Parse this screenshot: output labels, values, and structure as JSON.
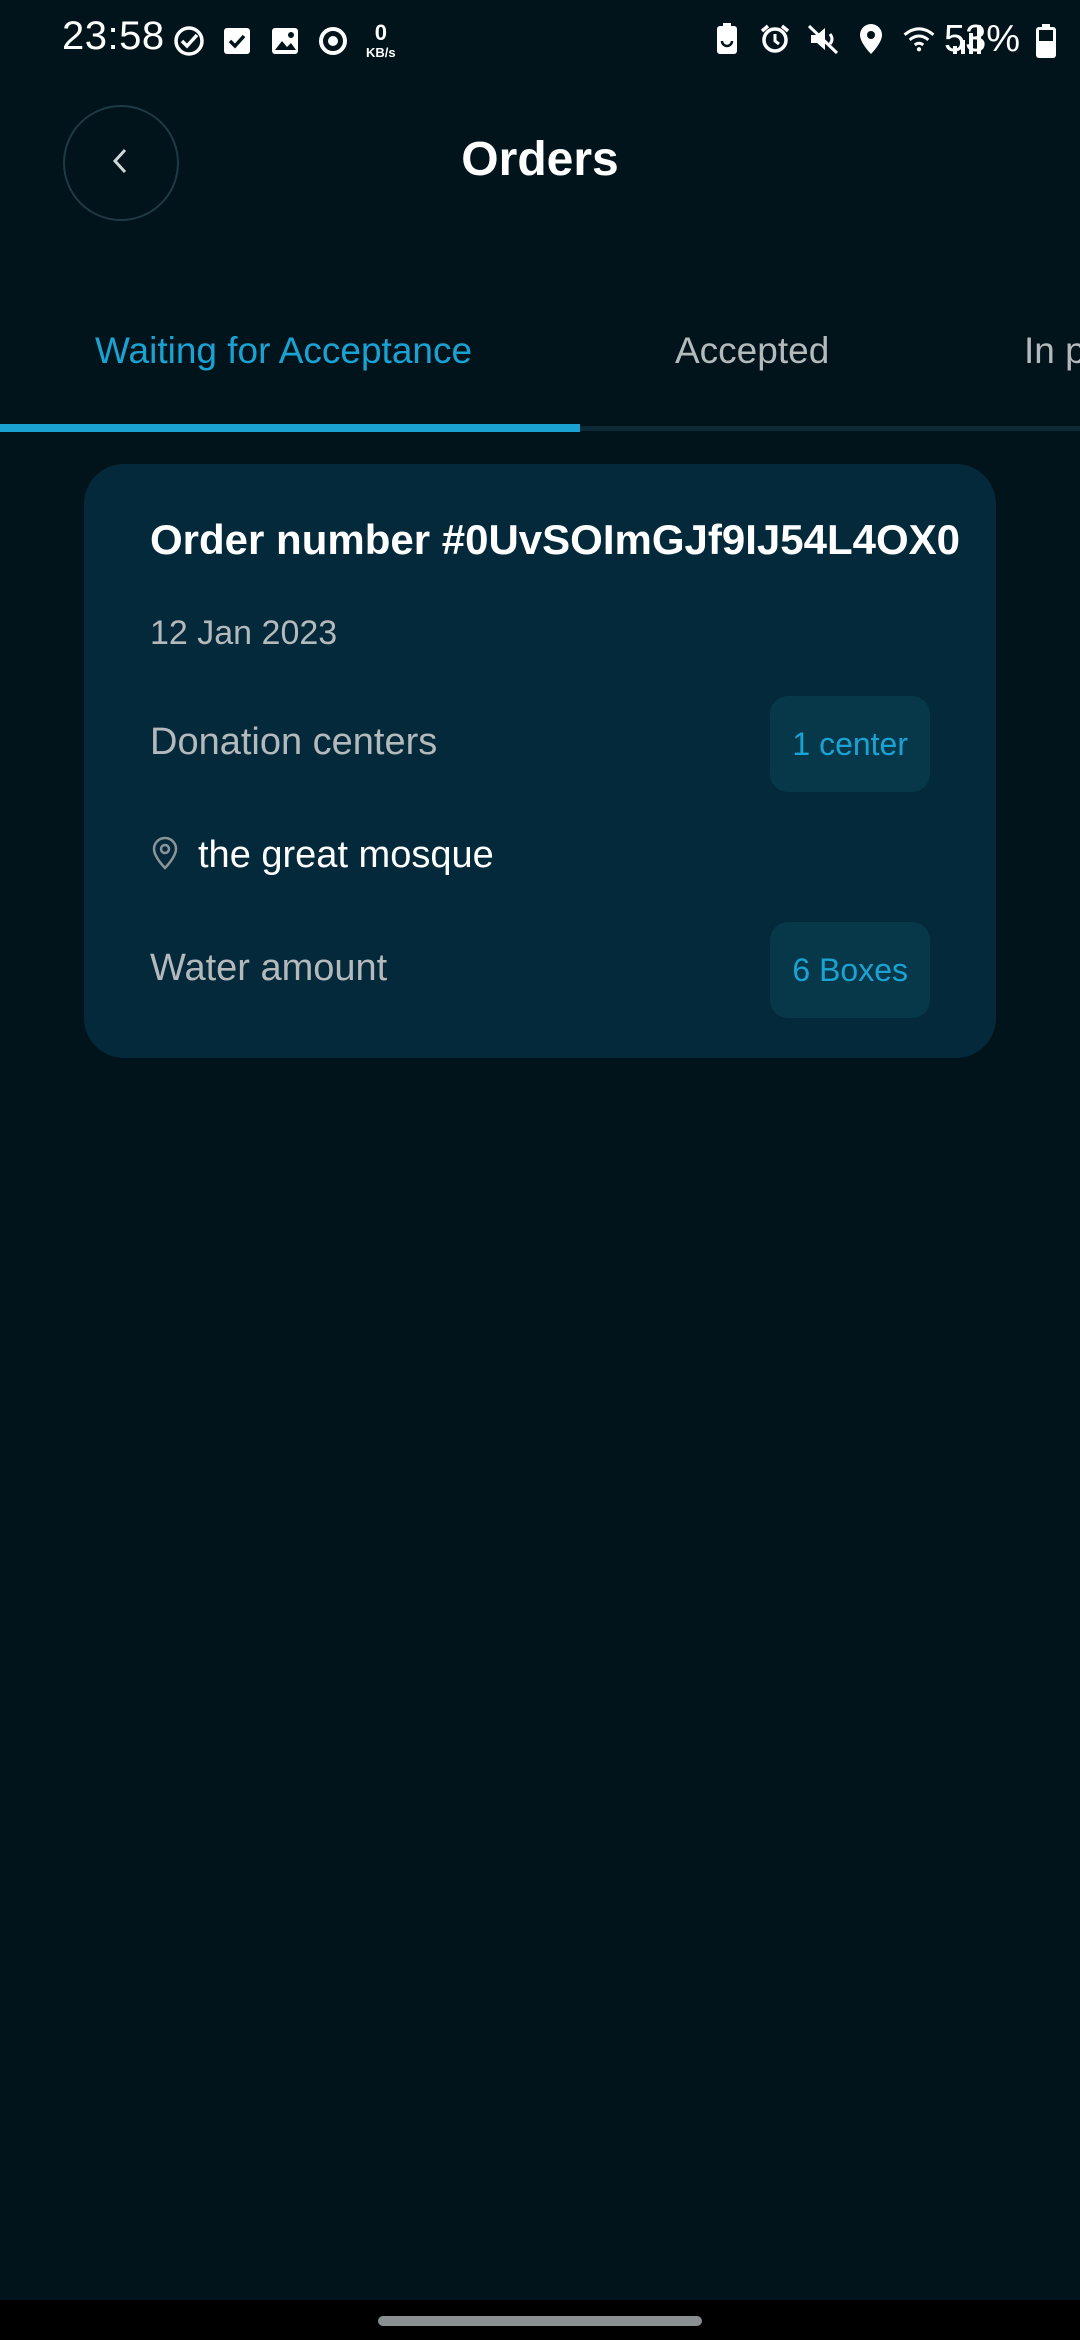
{
  "status_bar": {
    "time": "23:58",
    "net_speed_value": "0",
    "net_speed_unit": "KB/s",
    "battery_percent": "53%",
    "left_icons": [
      "check-circle-icon",
      "checkbox-icon",
      "image-icon",
      "sync-icon"
    ],
    "right_icons": [
      "battery-saver-icon",
      "alarm-icon",
      "mute-icon",
      "location-icon",
      "wifi-icon",
      "signal-icon"
    ]
  },
  "header": {
    "title": "Orders"
  },
  "tabs": [
    {
      "label": "Waiting for Acceptance",
      "active": true
    },
    {
      "label": "Accepted",
      "active": false
    },
    {
      "label": "In p",
      "active": false
    }
  ],
  "orders": [
    {
      "title": "Order number #0UvSOImGJf9IJ54L4OX0",
      "date": "12 Jan 2023",
      "centers_label": "Donation centers",
      "centers_badge": "1 center",
      "location": "the great mosque",
      "water_label": "Water amount",
      "water_badge": "6 Boxes"
    }
  ],
  "colors": {
    "background": "#01141b",
    "card": "#04293a",
    "accent": "#1aa3d2",
    "muted_text": "#b4b9bc"
  }
}
